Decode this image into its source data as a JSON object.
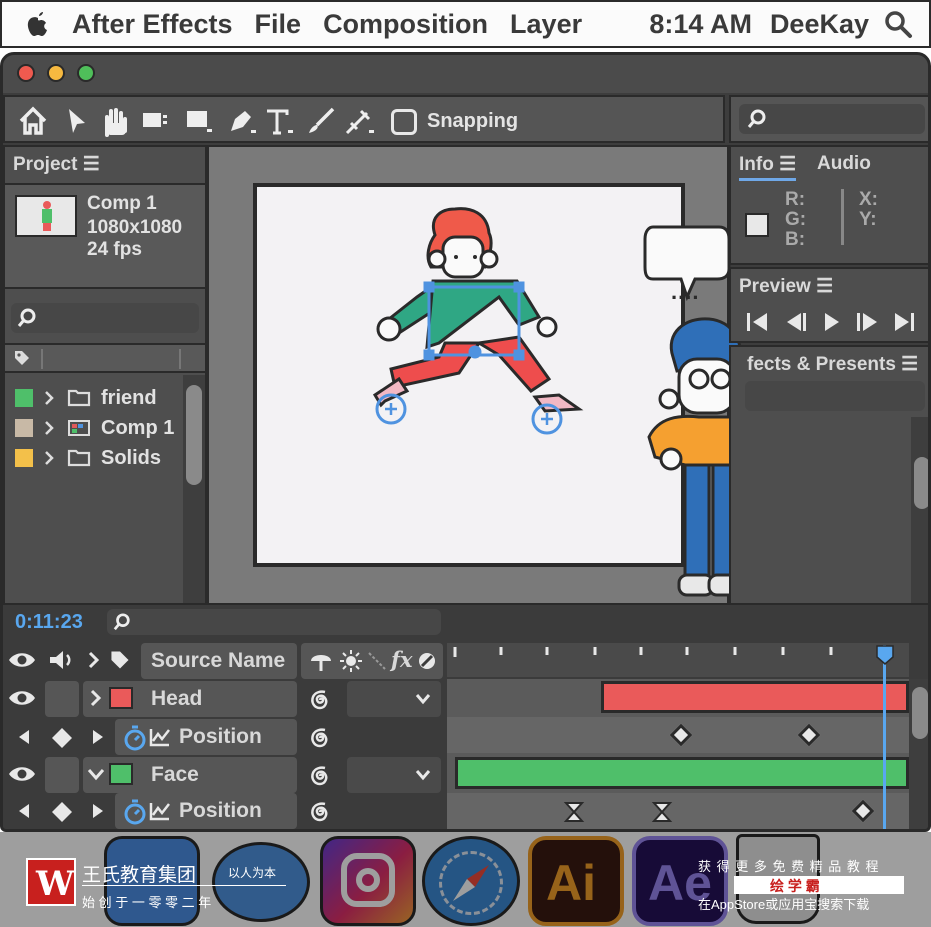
{
  "menubar": {
    "app_name": "After Effects",
    "menus": [
      "File",
      "Composition",
      "Layer"
    ],
    "time": "8:14 AM",
    "user": "DeeKay"
  },
  "toolbar": {
    "snapping_label": "Snapping",
    "tools": [
      "home-icon",
      "selection-arrow-icon",
      "hand-icon",
      "zoom-icon",
      "rectangle-icon",
      "pen-icon",
      "type-icon",
      "brush-icon",
      "puppet-icon"
    ]
  },
  "project_panel": {
    "title": "Project ☰",
    "comp": {
      "name": "Comp 1",
      "size": "1080x1080",
      "fps": "24 fps"
    },
    "items": [
      {
        "name": "friend",
        "color": "#4fbf6a",
        "type": "folder"
      },
      {
        "name": "Comp 1",
        "color": "#c8b9a6",
        "type": "composition"
      },
      {
        "name": "Solids",
        "color": "#f3c04a",
        "type": "folder"
      }
    ]
  },
  "info_panel": {
    "tabs": [
      "Info ☰",
      "Audio"
    ],
    "rgb": [
      "R:",
      "G:",
      "B:"
    ],
    "xy": [
      "X:",
      "Y:"
    ]
  },
  "preview_panel": {
    "title": "Preview ☰"
  },
  "effects_panel": {
    "title": "fects & Presents ☰"
  },
  "canvas": {
    "speech_bubble": "...."
  },
  "timeline": {
    "timecode": "0:11:23",
    "column_header": "Source Name",
    "column_icons": [
      "eye-icon",
      "audio-icon",
      "chevron-icon",
      "tag-icon",
      "switches-icon",
      "fx-icon",
      "motion-blur-icon"
    ],
    "layers": [
      {
        "name": "Head",
        "color": "#ea5a5a",
        "expanded": false,
        "property": "Position"
      },
      {
        "name": "Face",
        "color": "#4fbf6a",
        "expanded": true,
        "property": "Position"
      }
    ]
  },
  "colors": {
    "head_bar": "#ea5a5a",
    "face_bar": "#4fbf6a",
    "accent_blue": "#4f93e0",
    "timecode_blue": "#59a7ef"
  },
  "dock": {
    "icons": [
      "finder-icon",
      "messages-icon",
      "instagram-icon",
      "safari-icon",
      "illustrator-icon",
      "after-effects-icon",
      "trash-icon"
    ],
    "ai_label": "Ai",
    "ae_label": "Ae"
  },
  "watermark": {
    "left_title": "王氏教育集团",
    "left_tagline": "以人为本",
    "left_sub": "始 创 于 一 零 零 二 年",
    "right_line1": "获 得 更 多 免 费 精 品 教 程",
    "right_brand": "绘 学 霸",
    "right_line3": "在AppStore或应用宝搜索下载"
  }
}
